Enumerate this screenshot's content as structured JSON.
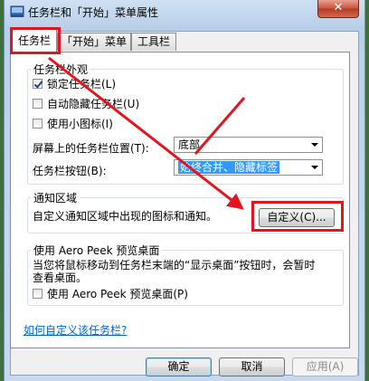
{
  "window": {
    "title": "任务栏和「开始」菜单属性",
    "close_label": "✕"
  },
  "tabs": [
    {
      "label": "任务栏",
      "active": true
    },
    {
      "label": "「开始」菜单",
      "active": false
    },
    {
      "label": "工具栏",
      "active": false
    }
  ],
  "appearance": {
    "group_label": "任务栏外观",
    "lock_taskbar": {
      "label": "锁定任务栏(L)",
      "checked": true
    },
    "auto_hide": {
      "label": "自动隐藏任务栏(U)",
      "checked": false
    },
    "small_icons": {
      "label": "使用小图标(I)",
      "checked": false
    },
    "position_label": "屏幕上的任务栏位置(T):",
    "position_value": "底部",
    "buttons_label": "任务栏按钮(B):",
    "buttons_value": "始终合并、隐藏标签"
  },
  "notification": {
    "group_label": "通知区域",
    "description": "自定义通知区域中出现的图标和通知。",
    "customize_button": "自定义(C)..."
  },
  "aero_peek": {
    "group_label": "使用 Aero Peek 预览桌面",
    "description_line1": "当您将鼠标移动到任务栏末端的“显示桌面”按钮时，会暂时",
    "description_line2": "查看桌面。",
    "checkbox": {
      "label": "使用 Aero Peek 预览桌面(P)",
      "checked": false
    }
  },
  "help_link": "如何自定义该任务栏?",
  "footer": {
    "ok": "确定",
    "cancel": "取消",
    "apply": "应用(A)"
  },
  "colors": {
    "annotation": "#e5131d",
    "link": "#0066cc"
  }
}
